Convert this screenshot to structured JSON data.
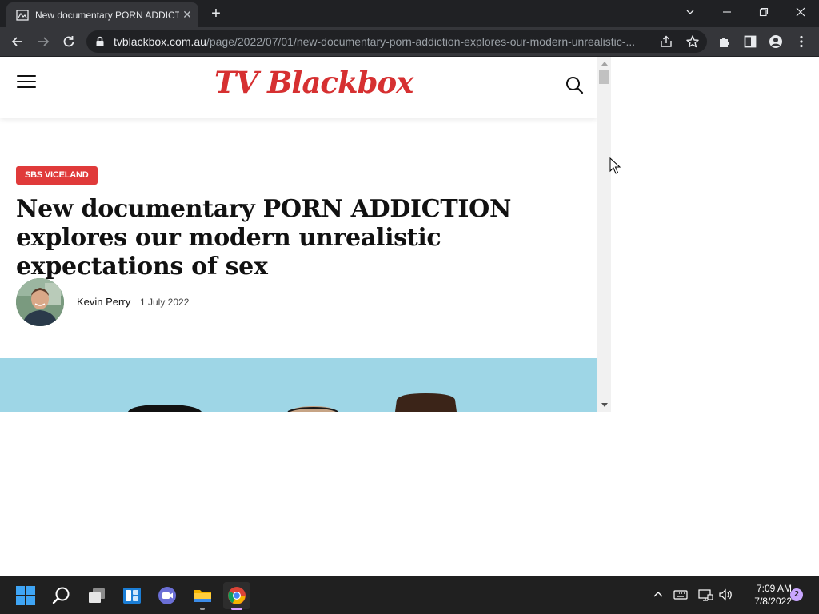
{
  "browser": {
    "tab": {
      "title": "New documentary PORN ADDICTION explores our modern unrealistic expectations of sex"
    },
    "url": {
      "host": "tvblackbox.com.au",
      "path": "/page/2022/07/01/new-documentary-porn-addiction-explores-our-modern-unrealistic-..."
    }
  },
  "site": {
    "logo": "TV Blackbox"
  },
  "article": {
    "category": "SBS VICELAND",
    "headline": "New documentary PORN ADDICTION explores our modern unrealistic expectations of sex",
    "author": "Kevin Perry",
    "date": "1 July 2022"
  },
  "taskbar": {
    "time": "7:09 AM",
    "date": "7/8/2022",
    "notification_count": "2"
  },
  "colors": {
    "brand": "#d63031",
    "category_badge": "#e03a3a",
    "hero_bg": "#9ed6e6"
  }
}
